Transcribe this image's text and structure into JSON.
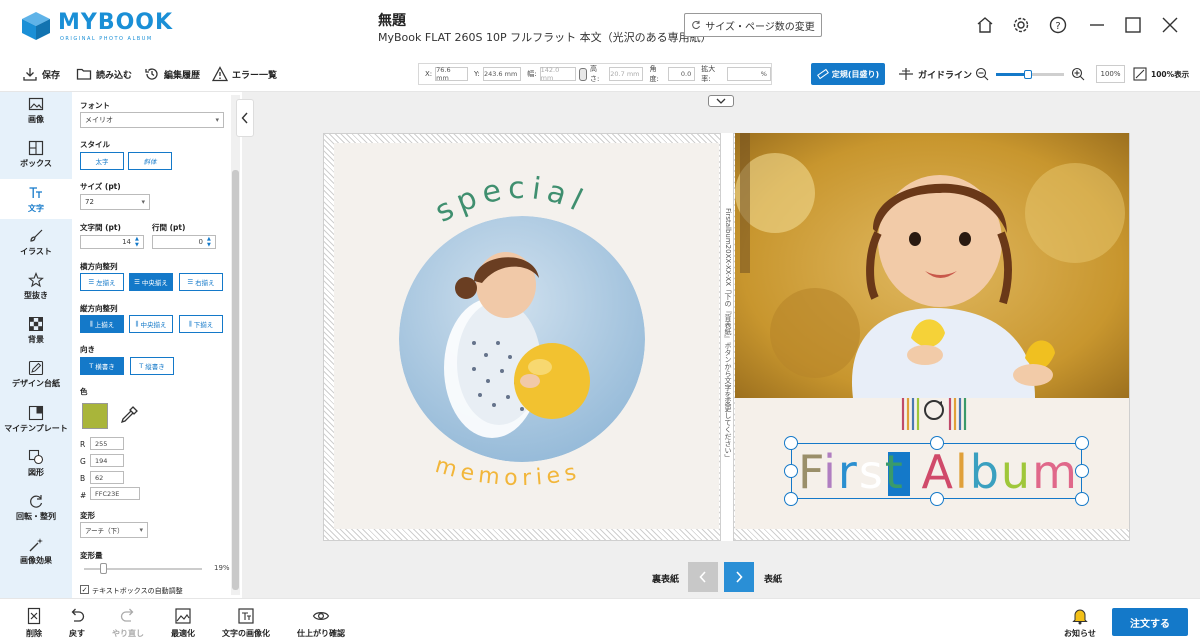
{
  "app": {
    "logo_text": "MYBOOK",
    "logo_sub": "ORIGINAL PHOTO ALBUM",
    "doc_title": "無題",
    "doc_subtitle": "MyBook FLAT 260S 10P フルフラット 本文（光沢のある専用紙）",
    "size_change_label": "サイズ・ページ数の変更"
  },
  "toolbar": {
    "save": "保存",
    "load": "読み込む",
    "history": "編集履歴",
    "errors": "エラー一覧",
    "x_label": "X:",
    "x_value": "76.6 mm",
    "y_label": "Y:",
    "y_value": "243.6 mm",
    "w_label": "幅:",
    "w_value": "142.0 mm",
    "h_label": "高さ:",
    "h_value": "20.7 mm",
    "angle_label": "角度:",
    "angle_value": "0.0",
    "zoom_label": "拡大率:",
    "zoom_unit": "%",
    "ruler_btn": "定規(目盛り)",
    "guide": "ガイドライン",
    "zoom_value": "100%",
    "zoom_100": "100%表示"
  },
  "sidebar": [
    {
      "label": "画像",
      "icon": "image-icon"
    },
    {
      "label": "ボックス",
      "icon": "box-icon"
    },
    {
      "label": "文字",
      "icon": "text-icon"
    },
    {
      "label": "イラスト",
      "icon": "brush-icon"
    },
    {
      "label": "型抜き",
      "icon": "star-icon"
    },
    {
      "label": "背景",
      "icon": "checker-icon"
    },
    {
      "label": "デザイン台紙",
      "icon": "pen-icon"
    },
    {
      "label": "マイテンプレート",
      "icon": "template-icon"
    },
    {
      "label": "図形",
      "icon": "shape-icon"
    },
    {
      "label": "回転・整列",
      "icon": "rotate-icon"
    },
    {
      "label": "画像効果",
      "icon": "wand-icon"
    }
  ],
  "props": {
    "font_label": "フォント",
    "font_value": "メイリオ",
    "style_label": "スタイル",
    "bold": "太字",
    "italic": "斜体",
    "size_label": "サイズ (pt)",
    "size_value": "72",
    "char_spacing_label": "文字間 (pt)",
    "char_spacing_value": "14",
    "line_spacing_label": "行間 (pt)",
    "line_spacing_value": "0",
    "halign_label": "横方向整列",
    "h_left": "左揃え",
    "h_center": "中央揃え",
    "h_right": "右揃え",
    "valign_label": "縦方向整列",
    "v_top": "上揃え",
    "v_middle": "中央揃え",
    "v_bottom": "下揃え",
    "direction_label": "向き",
    "dir_horizontal": "横書き",
    "dir_vertical": "縦書き",
    "color_label": "色",
    "color_hex_swatch": "#A9B53A",
    "r_label": "R",
    "r_value": "255",
    "g_label": "G",
    "g_value": "194",
    "b_label": "B",
    "b_value": "62",
    "hex_label": "#",
    "hex_value": "FFC23E",
    "transform_label": "変形",
    "transform_value": "アーチ（下）",
    "amount_label": "変形量",
    "amount_value": "19%",
    "auto_adjust_label": "テキストボックスの自動調整"
  },
  "canvas": {
    "special_text": "special",
    "memories_text": "memories",
    "spine_text": "Firstalbum20XX-XX-XX「下の『背表紙』ボタンから文字を変更してください」",
    "title_text_1": "Fir",
    "title_text_2": "s",
    "title_text_3": "t Album",
    "colors": {
      "special": "#3f8f6f",
      "memories": "#f2b63a",
      "title_f": "#9a8f6a",
      "title_i": "#b07ec1",
      "title_r": "#2a8fd0",
      "title_s": "#4a5ea8",
      "title_t": "#3a9a6a",
      "title_A": "#d04a6a",
      "title_l": "#e0a03a",
      "title_b": "#3aa0c0",
      "title_u": "#9fc73a",
      "title_m": "#e0688a"
    }
  },
  "pager": {
    "back_label": "裏表紙",
    "front_label": "表紙"
  },
  "bottombar": {
    "delete": "削除",
    "undo": "戻す",
    "redo": "やり直し",
    "optimize": "最適化",
    "text_to_image": "文字の画像化",
    "preview": "仕上がり確認",
    "notice": "お知らせ",
    "order": "注文する"
  }
}
